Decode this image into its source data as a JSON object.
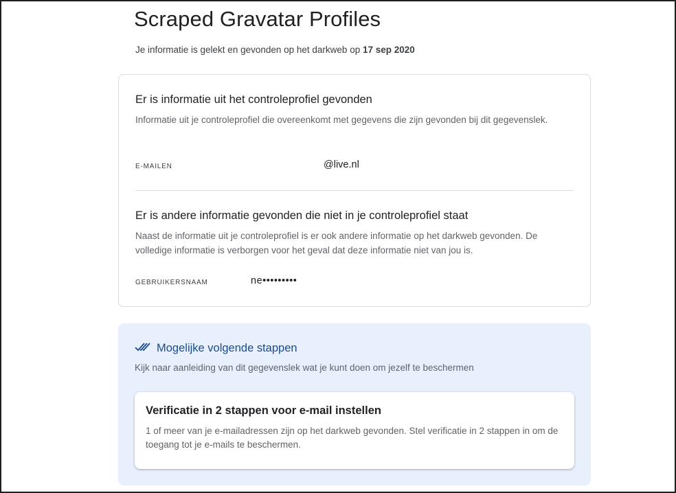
{
  "header": {
    "title": "Scraped Gravatar Profiles",
    "subtitle_prefix": "Je informatie is gelekt en gevonden op het darkweb op ",
    "subtitle_date": "17 sep 2020"
  },
  "monitored": {
    "title": "Er is informatie uit het controleprofiel gevonden",
    "description": "Informatie uit je controleprofiel die overeenkomt met gegevens die zijn gevonden bij dit gegevenslek.",
    "field_label": "E-MAILEN",
    "field_value": "@live.nl"
  },
  "other": {
    "title": "Er is andere informatie gevonden die niet in je controleprofiel staat",
    "description": "Naast de informatie uit je controleprofiel is er ook andere informatie op het darkweb gevonden. De volledige informatie is verborgen voor het geval dat deze informatie niet van jou is.",
    "field_label": "GEBRUIKERSNAAM",
    "field_value": "ne•••••••••"
  },
  "next_steps": {
    "icon": "double-check-icon",
    "title": "Mogelijke volgende stappen",
    "description": "Kijk naar aanleiding van dit gegevenslek wat je kunt doen om jezelf te beschermen",
    "recommendation": {
      "title": "Verificatie in 2 stappen voor e-mail instellen",
      "description": "1 of meer van je e-mailadressen zijn op het darkweb gevonden. Stel verificatie in 2 stappen in om de toegang tot je e-mails te beschermen."
    }
  },
  "colors": {
    "accent": "#1a4b8c",
    "steps_background": "#e8f0fe",
    "border": "#dadce0"
  }
}
